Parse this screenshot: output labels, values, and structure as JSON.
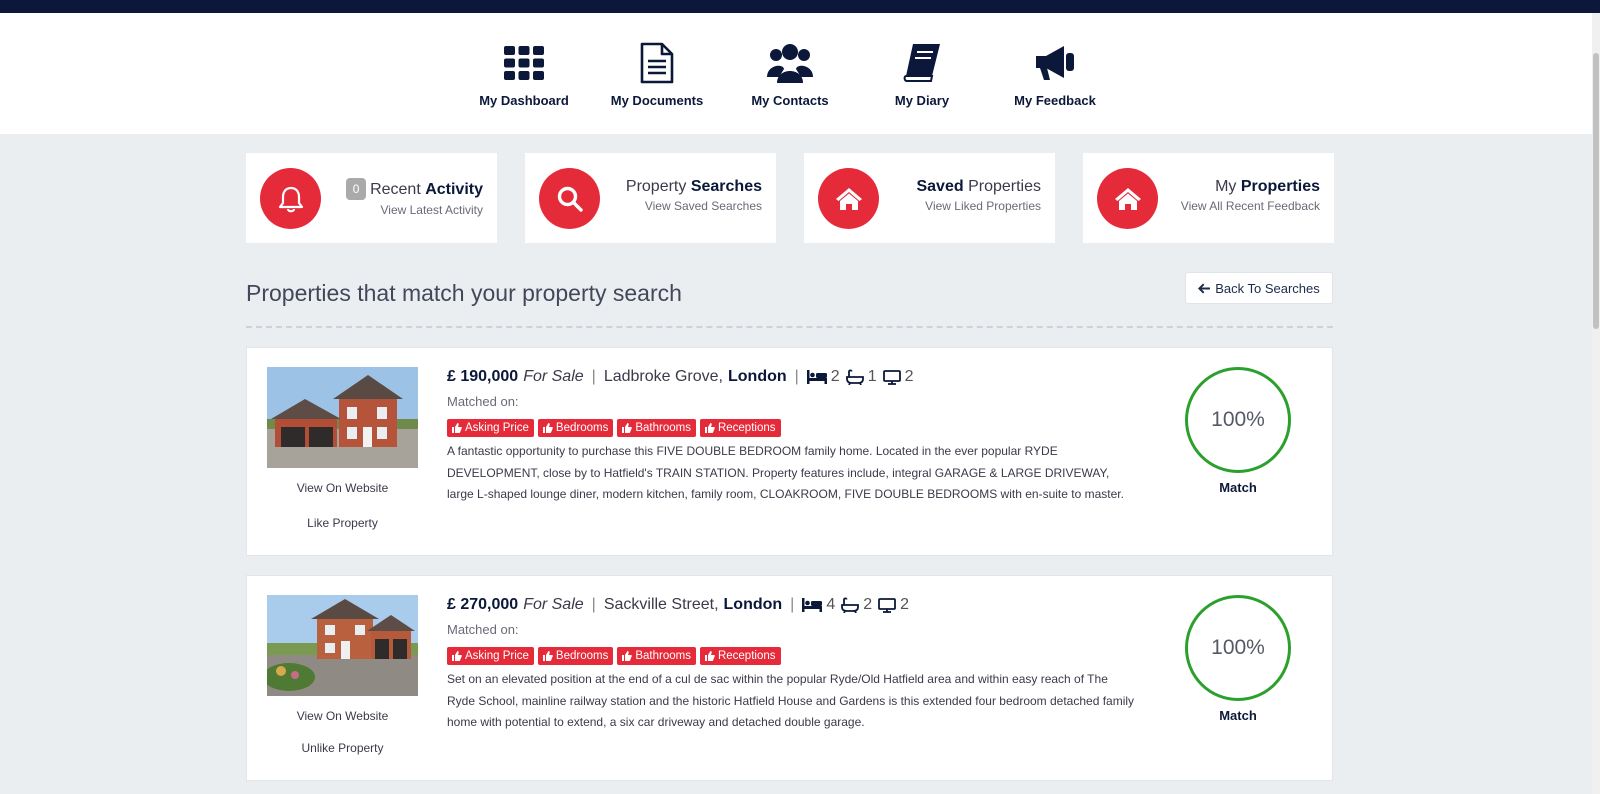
{
  "nav": {
    "items": [
      {
        "label": "My Dashboard",
        "icon": "th-grid-icon"
      },
      {
        "label": "My Documents",
        "icon": "document-icon"
      },
      {
        "label": "My Contacts",
        "icon": "users-icon"
      },
      {
        "label": "My Diary",
        "icon": "book-icon"
      },
      {
        "label": "My Feedback",
        "icon": "megaphone-icon"
      }
    ]
  },
  "cards": [
    {
      "badge": "0",
      "title_plain": "Recent ",
      "title_bold": "Activity",
      "subtitle": "View Latest Activity",
      "icon": "bell-icon"
    },
    {
      "title_plain": "Property ",
      "title_bold": "Searches",
      "subtitle": "View Saved Searches",
      "icon": "search-icon"
    },
    {
      "title_bold": "Saved",
      "title_plain": " Properties",
      "subtitle": "View Liked Properties",
      "icon": "home-icon"
    },
    {
      "title_plain": "My ",
      "title_bold": "Properties",
      "subtitle": "View All Recent Feedback",
      "icon": "home-icon"
    }
  ],
  "section": {
    "title": "Properties that match your property search",
    "back_label": "Back To Searches"
  },
  "properties": [
    {
      "price": "£ 190,000",
      "status": "For Sale",
      "street": "Ladbroke Grove,",
      "city": "London",
      "beds": "2",
      "baths": "1",
      "receptions": "2",
      "matched_label": "Matched on:",
      "tags": [
        "Asking Price",
        "Bedrooms",
        "Bathrooms",
        "Receptions"
      ],
      "description": "A fantastic opportunity to purchase this FIVE DOUBLE BEDROOM family home. Located in the ever popular RYDE DEVELOPMENT, close by to Hatfield's TRAIN STATION. Property features include, integral GARAGE & LARGE DRIVEWAY, large L-shaped lounge diner, modern kitchen, family room, CLOAKROOM, FIVE DOUBLE BEDROOMS with en-suite to master.",
      "view_label": "View On Website",
      "like_label": "Like Property",
      "match_percent": "100%",
      "match_label": "Match"
    },
    {
      "price": "£ 270,000",
      "status": "For Sale",
      "street": "Sackville Street,",
      "city": "London",
      "beds": "4",
      "baths": "2",
      "receptions": "2",
      "matched_label": "Matched on:",
      "tags": [
        "Asking Price",
        "Bedrooms",
        "Bathrooms",
        "Receptions"
      ],
      "description": "Set on an elevated position at the end of a cul de sac within the popular Ryde/Old Hatfield area and within easy reach of The Ryde School, mainline railway station and the historic Hatfield House and Gardens is this extended four bedroom detached family home with potential to extend, a six car driveway and detached double garage.",
      "view_label": "View On Website",
      "like_label": "Unlike Property",
      "match_percent": "100%",
      "match_label": "Match"
    }
  ],
  "colors": {
    "accent": "#e52b3a",
    "navy": "#0b1839",
    "match_ring": "#2ca02c",
    "background": "#ebeef1"
  }
}
